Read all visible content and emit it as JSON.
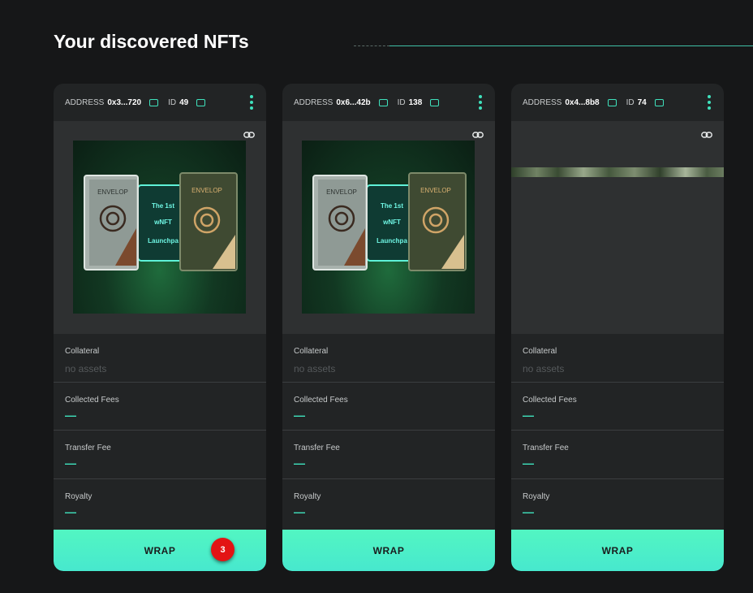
{
  "page": {
    "title": "Your discovered NFTs"
  },
  "cards": [
    {
      "address_label": "ADDRESS",
      "address": "0x3...720",
      "id_label": "ID",
      "id": "49",
      "image": "nft-artwork",
      "collateral_label": "Collateral",
      "collateral_value": "no assets",
      "collected_fees_label": "Collected Fees",
      "collected_fees_value": "—",
      "transfer_fee_label": "Transfer Fee",
      "transfer_fee_value": "—",
      "royalty_label": "Royalty",
      "royalty_value": "—",
      "wrap_label": "WRAP",
      "badge": "3"
    },
    {
      "address_label": "ADDRESS",
      "address": "0x6...42b",
      "id_label": "ID",
      "id": "138",
      "image": "nft-artwork",
      "collateral_label": "Collateral",
      "collateral_value": "no assets",
      "collected_fees_label": "Collected Fees",
      "collected_fees_value": "—",
      "transfer_fee_label": "Transfer Fee",
      "transfer_fee_value": "—",
      "royalty_label": "Royalty",
      "royalty_value": "—",
      "wrap_label": "WRAP"
    },
    {
      "address_label": "ADDRESS",
      "address": "0x4...8b8",
      "id_label": "ID",
      "id": "74",
      "image": "broken-image-strip",
      "collateral_label": "Collateral",
      "collateral_value": "no assets",
      "collected_fees_label": "Collected Fees",
      "collected_fees_value": "—",
      "transfer_fee_label": "Transfer Fee",
      "transfer_fee_value": "—",
      "royalty_label": "Royalty",
      "royalty_value": "—",
      "wrap_label": "WRAP"
    }
  ],
  "artwork": {
    "left_plate_text": "ENVELOP",
    "right_plate_text": "ENVELOP",
    "screen_lines": [
      "The 1st",
      "wNFT",
      "Launchpa"
    ]
  },
  "colors": {
    "accent": "#3fe2bd",
    "wrap_button": "#4ef0c8",
    "badge": "#e31414",
    "card_bg": "#222425",
    "page_bg": "#161718"
  }
}
